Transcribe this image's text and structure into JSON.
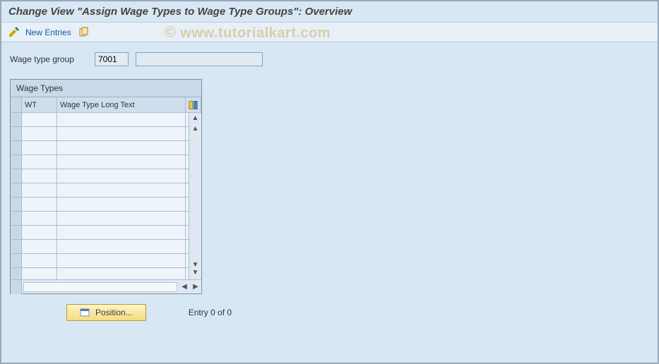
{
  "title": "Change View \"Assign Wage Types to Wage Type Groups\": Overview",
  "toolbar": {
    "new_entries": "New Entries"
  },
  "watermark": "www.tutorialkart.com",
  "fields": {
    "wage_type_group_label": "Wage type group",
    "wage_type_group_value": "7001",
    "wage_type_group_desc": ""
  },
  "table": {
    "title": "Wage Types",
    "columns": {
      "wt": "WT",
      "long": "Wage Type Long Text"
    },
    "rows": [
      {
        "wt": "",
        "long": ""
      },
      {
        "wt": "",
        "long": ""
      },
      {
        "wt": "",
        "long": ""
      },
      {
        "wt": "",
        "long": ""
      },
      {
        "wt": "",
        "long": ""
      },
      {
        "wt": "",
        "long": ""
      },
      {
        "wt": "",
        "long": ""
      },
      {
        "wt": "",
        "long": ""
      },
      {
        "wt": "",
        "long": ""
      },
      {
        "wt": "",
        "long": ""
      },
      {
        "wt": "",
        "long": ""
      },
      {
        "wt": "",
        "long": ""
      }
    ]
  },
  "footer": {
    "position_button": "Position...",
    "entry_text": "Entry 0 of 0"
  }
}
